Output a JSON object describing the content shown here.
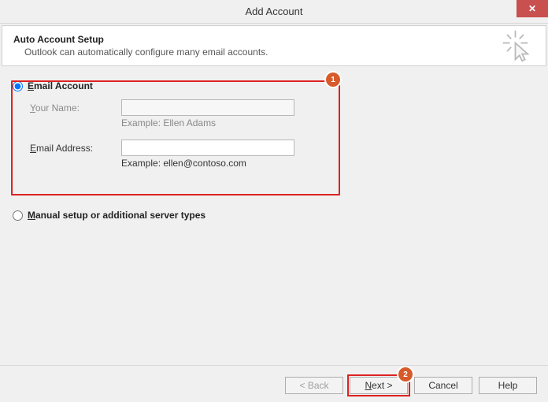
{
  "window": {
    "title": "Add Account",
    "close_symbol": "✕"
  },
  "header": {
    "heading": "Auto Account Setup",
    "subheading": "Outlook can automatically configure many email accounts."
  },
  "options": {
    "email_account_label": "Email Account",
    "manual_label": "Manual setup or additional server types"
  },
  "fields": {
    "your_name_label": "Your Name:",
    "your_name_value": "",
    "your_name_hint": "Example: Ellen Adams",
    "email_label": "Email Address:",
    "email_value": "",
    "email_hint": "Example: ellen@contoso.com"
  },
  "callouts": {
    "one": "1",
    "two": "2"
  },
  "buttons": {
    "back": "< Back",
    "next": "Next >",
    "cancel": "Cancel",
    "help": "Help"
  }
}
